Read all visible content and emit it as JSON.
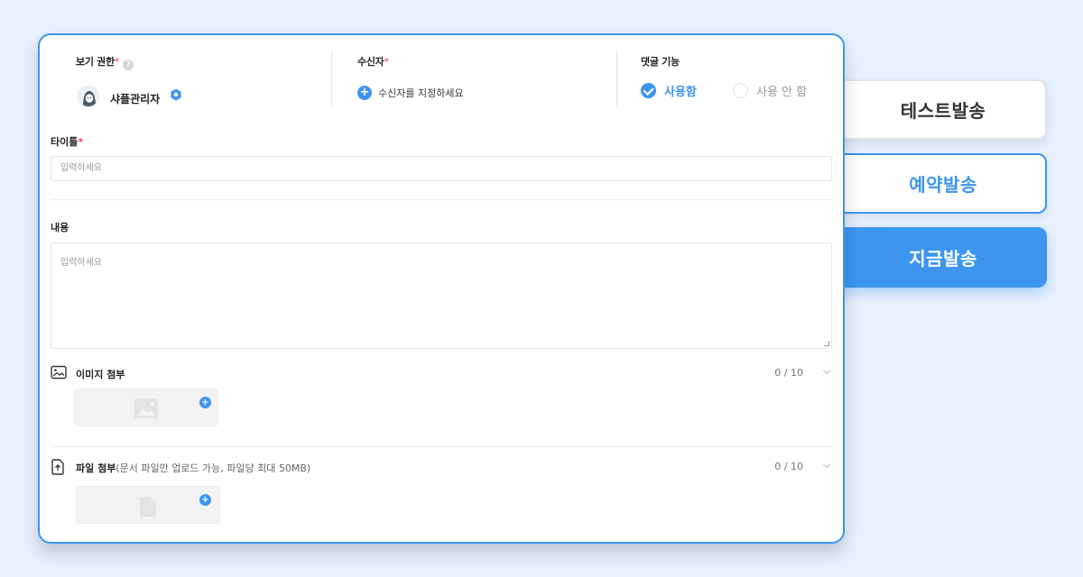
{
  "visibility": {
    "label": "보기 권한",
    "required_mark": "*",
    "help_icon": "question-icon",
    "help_glyph": "?",
    "admin_name": "샤플관리자",
    "avatar_icon": "avatar",
    "settings_icon": "gear-icon"
  },
  "recipient": {
    "label": "수신자",
    "required_mark": "*",
    "add_glyph": "+",
    "add_text": "수신자를 지정하세요"
  },
  "comment": {
    "label": "댓글 기능",
    "option_on": "사용함",
    "option_off": "사용 안 함",
    "selected": "사용함"
  },
  "title": {
    "label": "타이틀",
    "required_mark": "*",
    "placeholder": "입력하세요"
  },
  "content": {
    "label": "내용",
    "placeholder": "입력하세요"
  },
  "image_attach": {
    "icon": "image-icon",
    "label": "이미지 첨부",
    "count": "0 / 10",
    "add_glyph": "+"
  },
  "file_attach": {
    "icon": "file-upload-icon",
    "label": "파일 첨부",
    "sublabel": "(문서 파일만 업로드 가능, 파일당 최대 50MB)",
    "count": "0 / 10",
    "add_glyph": "+"
  },
  "actions": {
    "test_send": "테스트발송",
    "reserve_send": "예약발송",
    "send_now": "지금발송"
  },
  "colors": {
    "accent": "#3d95ef",
    "required": "#f04452",
    "background": "#e7f1fd"
  }
}
